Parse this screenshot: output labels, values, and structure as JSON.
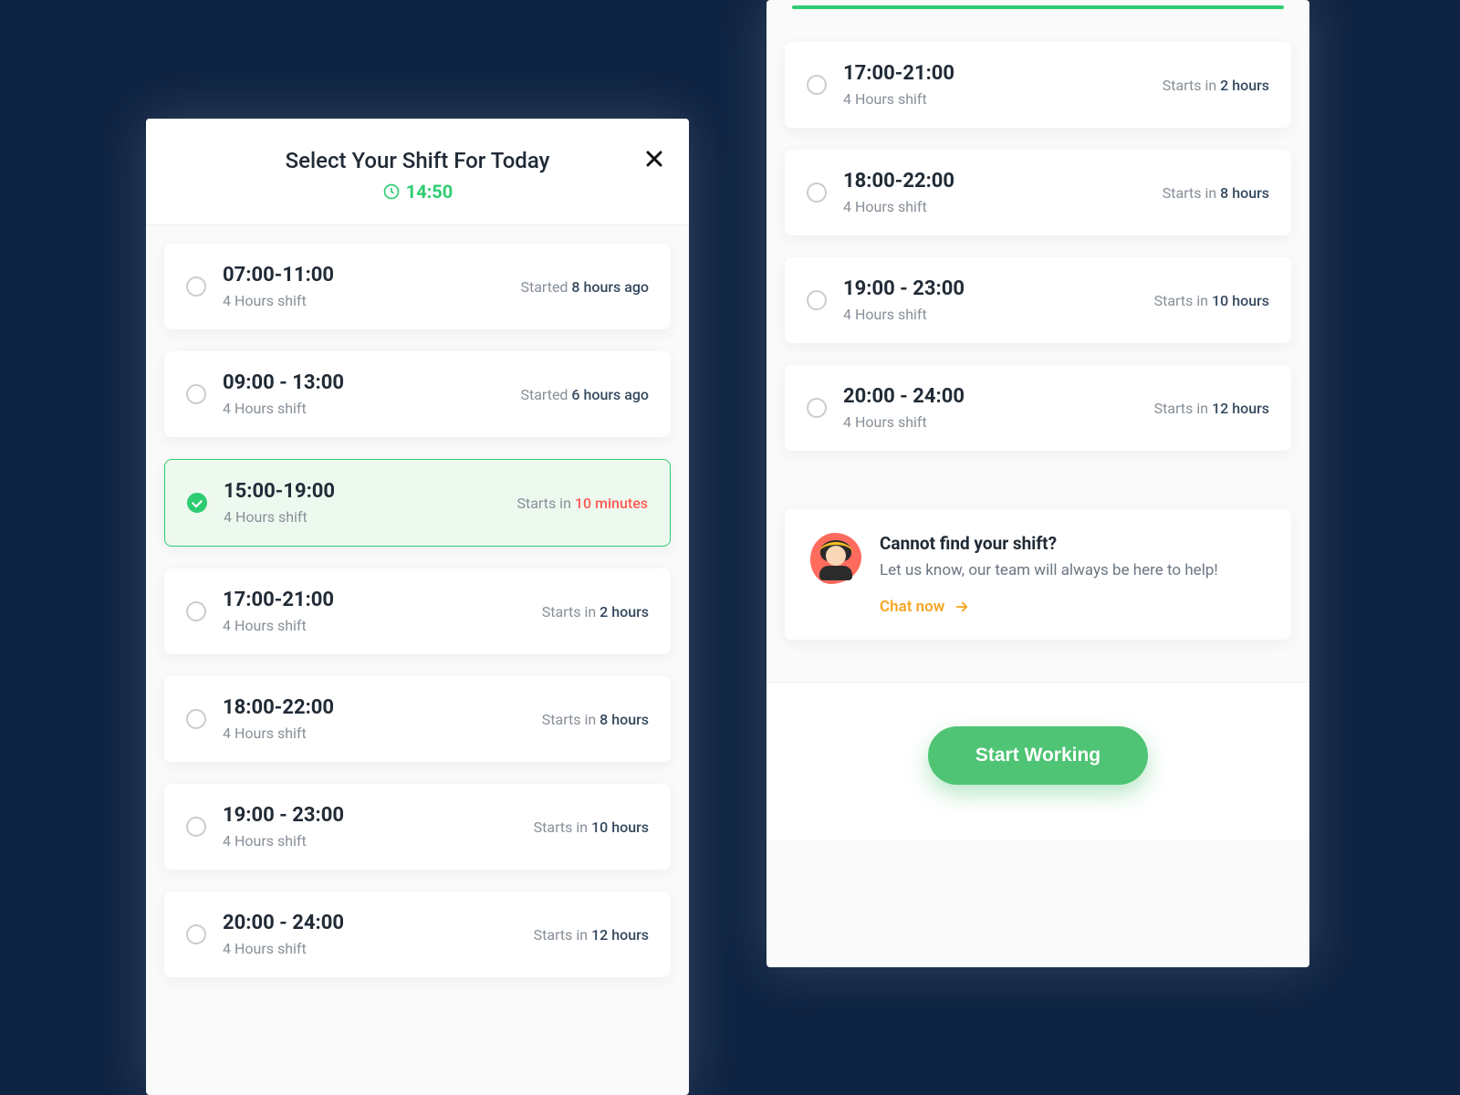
{
  "header": {
    "title": "Select Your Shift For Today",
    "current_time": "14:50"
  },
  "left_shifts": [
    {
      "time": "07:00-11:00",
      "duration": "4 Hours shift",
      "status_prefix": "Started ",
      "status_value": "8 hours ago",
      "urgent": false,
      "selected": false
    },
    {
      "time": "09:00 - 13:00",
      "duration": "4 Hours shift",
      "status_prefix": "Started ",
      "status_value": "6 hours ago",
      "urgent": false,
      "selected": false
    },
    {
      "time": "15:00-19:00",
      "duration": "4 Hours shift",
      "status_prefix": "Starts in ",
      "status_value": "10 minutes",
      "urgent": true,
      "selected": true
    },
    {
      "time": "17:00-21:00",
      "duration": "4 Hours shift",
      "status_prefix": "Starts in ",
      "status_value": "2 hours",
      "urgent": false,
      "selected": false
    },
    {
      "time": "18:00-22:00",
      "duration": "4 Hours shift",
      "status_prefix": "Starts in ",
      "status_value": "8 hours",
      "urgent": false,
      "selected": false
    },
    {
      "time": "19:00 - 23:00",
      "duration": "4 Hours shift",
      "status_prefix": "Starts in ",
      "status_value": "10 hours",
      "urgent": false,
      "selected": false
    },
    {
      "time": "20:00 - 24:00",
      "duration": "4 Hours shift",
      "status_prefix": "Starts in ",
      "status_value": "12 hours",
      "urgent": false,
      "selected": false
    }
  ],
  "right_shifts": [
    {
      "time": "17:00-21:00",
      "duration": "4 Hours shift",
      "status_prefix": "Starts in ",
      "status_value": "2 hours",
      "urgent": false,
      "selected": false
    },
    {
      "time": "18:00-22:00",
      "duration": "4 Hours shift",
      "status_prefix": "Starts in ",
      "status_value": "8 hours",
      "urgent": false,
      "selected": false
    },
    {
      "time": "19:00 - 23:00",
      "duration": "4 Hours shift",
      "status_prefix": "Starts in ",
      "status_value": "10 hours",
      "urgent": false,
      "selected": false
    },
    {
      "time": "20:00 - 24:00",
      "duration": "4 Hours shift",
      "status_prefix": "Starts in ",
      "status_value": "12 hours",
      "urgent": false,
      "selected": false
    }
  ],
  "help": {
    "title": "Cannot find your shift?",
    "text": "Let us know, our team will always be here to help!",
    "cta": "Chat now"
  },
  "footer": {
    "cta": "Start Working"
  }
}
